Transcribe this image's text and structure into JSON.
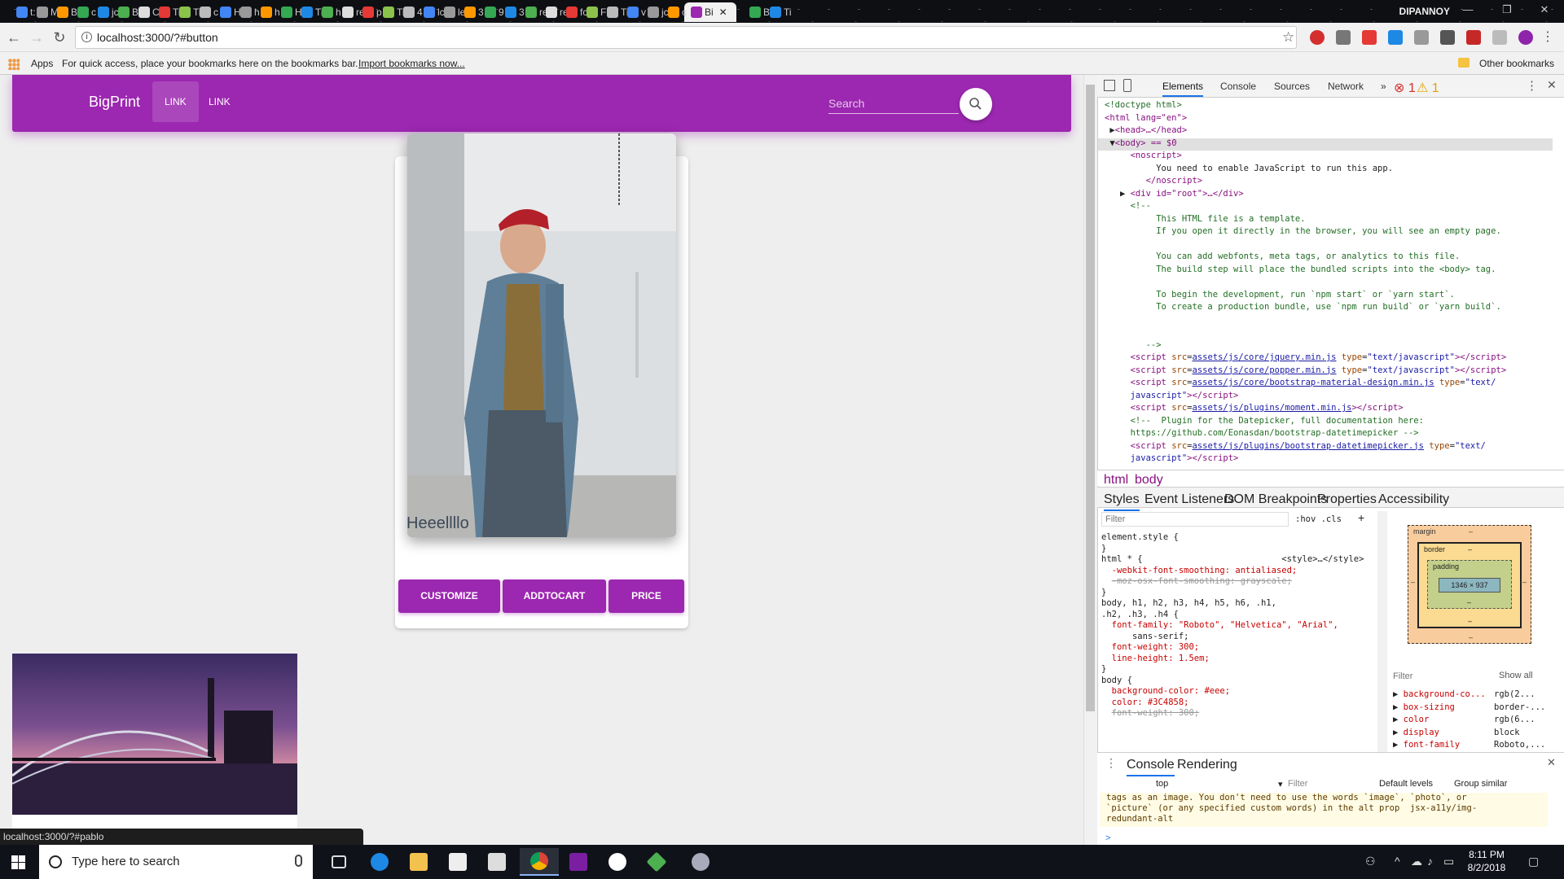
{
  "browser": {
    "active_tab_title": "Bi",
    "tabs": [
      "t:",
      "M",
      "B",
      "c",
      "jc",
      "B",
      "C",
      "Ti",
      "Ti",
      "c",
      "H",
      "h",
      "h",
      "H",
      "Ti",
      "h",
      "re",
      "p",
      "Ti",
      "4",
      "lc",
      "le",
      "3",
      "9",
      "3",
      "re",
      "re",
      "fc",
      "F",
      "Ti",
      "v",
      "jc",
      "c",
      "B",
      "Ti"
    ],
    "profile": "DIPANNOY",
    "url": "localhost:3000/?#button",
    "bookmarks": {
      "apps": "Apps",
      "hint": "For quick access, place your bookmarks here on the bookmarks bar.",
      "import": "Import bookmarks now...",
      "other": "Other bookmarks"
    },
    "status_url": "localhost:3000/?#pablo"
  },
  "page": {
    "brand": "BigPrint",
    "nav_links": [
      "LINK",
      "LINK"
    ],
    "search_placeholder": "Search",
    "card": {
      "title": "Heeellllo",
      "buttons": [
        "CUSTOMIZE",
        "ADDTOCART",
        "PRICE"
      ]
    }
  },
  "devtools": {
    "tabs": [
      "Elements",
      "Console",
      "Sources",
      "Network",
      "»"
    ],
    "errors": "1",
    "warnings": "1",
    "breadcrumb": [
      "html",
      "body"
    ],
    "styles_tabs": [
      "Styles",
      "Event Listeners",
      "DOM Breakpoints",
      "Properties",
      "Accessibility"
    ],
    "filter_placeholder": "Filter",
    "hov_cls": ":hov .cls",
    "dom": {
      "doctype": "<!doctype html>",
      "html_open": "<html lang=\"en\">",
      "head": "<head>…</head>",
      "body": "<body> == $0",
      "noscript_open": "<noscript>",
      "noscript_text": "You need to enable JavaScript to run this app.",
      "noscript_close": "</noscript>",
      "root_div": "<div id=\"root\">…</div>",
      "comment_open": "<!--",
      "comment_lines": [
        "This HTML file is a template.",
        "If you open it directly in the browser, you will see an empty page.",
        "",
        "You can add webfonts, meta tags, or analytics to this file.",
        "The build step will place the bundled scripts into the <body> tag.",
        "",
        "To begin the development, run `npm start` or `yarn start`.",
        "To create a production bundle, use `npm run build` or `yarn build`."
      ],
      "comment_close": "-->",
      "scripts": [
        "assets/js/core/jquery.min.js",
        "assets/js/core/popper.min.js",
        "assets/js/core/bootstrap-material-design.min.js",
        "assets/js/plugins/moment.min.js"
      ],
      "plugin_comment": "<!--  Plugin for the Datepicker, full documentation here:",
      "plugin_url": "https://github.com/Eonasdan/bootstrap-datetimepicker -->",
      "datetimepicker": "assets/js/plugins/bootstrap-datetimepicker.js"
    },
    "styles": {
      "element_style": "element.style {",
      "html_rule_selector": "html * {",
      "html_rule_source": "<style>…</style>",
      "font_smoothing": "-webkit-font-smoothing: antialiased;",
      "moz_smoothing": "-moz-osx-font-smoothing: grayscale;",
      "body_selector": "body, h1, h2, h3, h4, h5, h6, .h1,",
      "body_selector_2": ".h2, .h3, .h4 {",
      "font_family": "font-family: \"Roboto\", \"Helvetica\", \"Arial\",",
      "font_family_2": "sans-serif;",
      "font_weight": "font-weight: 300;",
      "line_height": "line-height: 1.5em;",
      "body_rule": "body {",
      "bg_color": "background-color: #eee;",
      "color": "color: #3C4858;",
      "font_weight_struck": "font-weight: 300;"
    },
    "box_model": {
      "margin": "margin",
      "border": "border",
      "padding": "padding",
      "content": "1346 × 937",
      "dash": "–"
    },
    "computed_filter": "Filter",
    "show_all": "Show all",
    "computed": [
      [
        "background-co...",
        "rgb(2..."
      ],
      [
        "box-sizing",
        "border-..."
      ],
      [
        "color",
        "rgb(6..."
      ],
      [
        "display",
        "block"
      ],
      [
        "font-family",
        "Roboto,..."
      ]
    ],
    "drawer_tabs": [
      "Console",
      "Rendering"
    ],
    "context": "top",
    "console_filter": "Filter",
    "levels": "Default levels",
    "group_similar": "Group similar",
    "console_message": "tags as an image. You don't need to use the words `image`, `photo`, or\n`picture` (or any specified custom words) in the alt prop  jsx-a11y/img-\nredundant-alt",
    "prompt": ">"
  },
  "taskbar": {
    "search_placeholder": "Type here to search",
    "time": "8:11 PM",
    "date": "8/2/2018"
  }
}
